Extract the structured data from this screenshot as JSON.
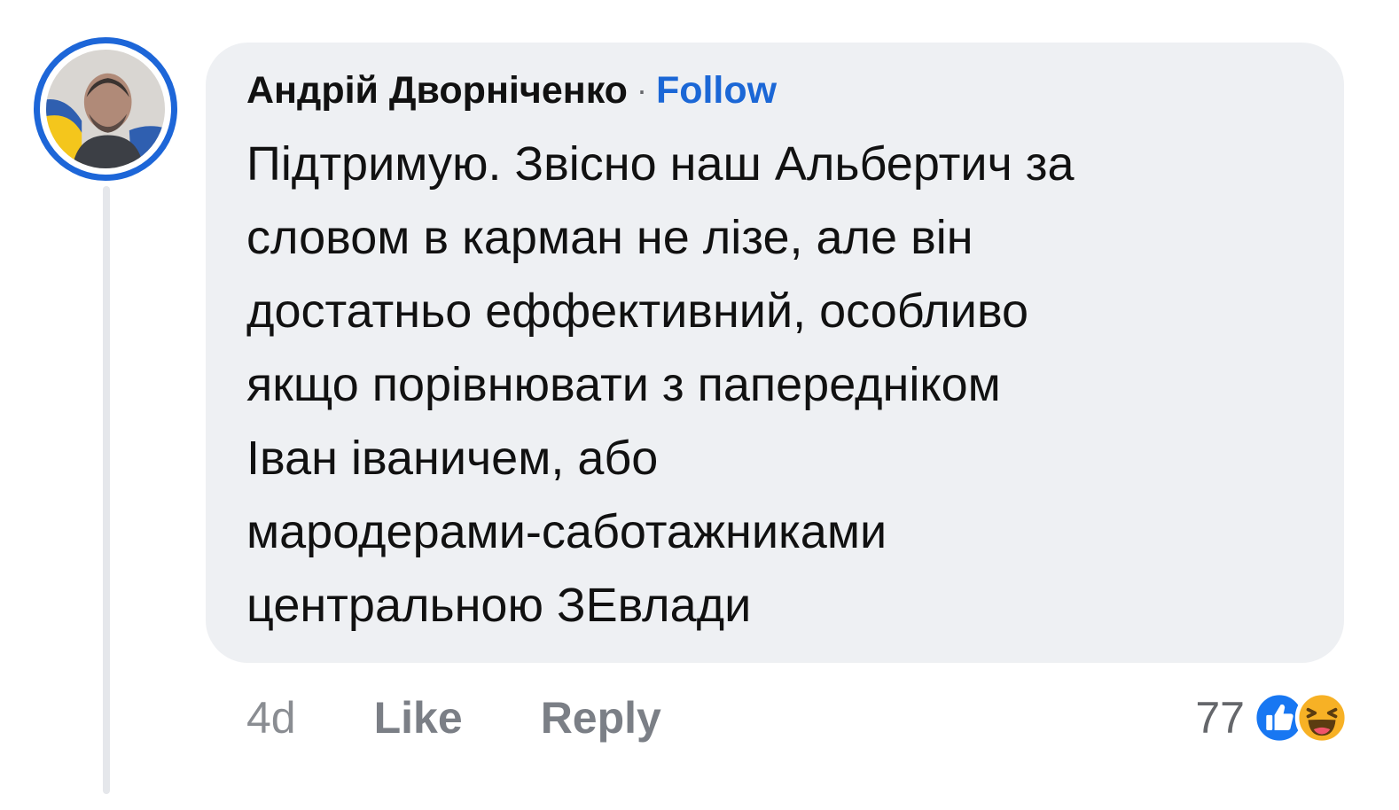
{
  "comment": {
    "author": "Андрій Дворніченко",
    "separator": "·",
    "follow_label": "Follow",
    "text_lines": [
      "Підтримую. Звісно наш Альбертич за",
      "словом в карман не лізе, але він",
      "достатньо еффективний, особливо",
      "якщо порівнювати з папередніком",
      "Іван іваничем, або",
      "мародерами-саботажниками",
      "центральною ЗЕвлади"
    ],
    "time_ago": "4d",
    "like_label": "Like",
    "reply_label": "Reply",
    "reaction_count": "77",
    "reactions": [
      "like-icon",
      "haha-icon"
    ]
  },
  "colors": {
    "follow": "#1b67d6",
    "bubble": "#eef0f3",
    "avatar_ring": "#1d66d8",
    "like_reaction": "#1877f2",
    "haha_reaction": "#f7b125"
  }
}
